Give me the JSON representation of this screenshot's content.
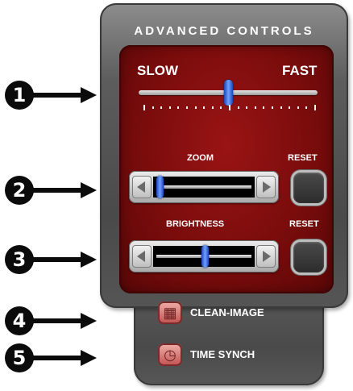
{
  "callouts": [
    "1",
    "2",
    "3",
    "4",
    "5"
  ],
  "panel": {
    "title": "ADVANCED CONTROLS"
  },
  "speed": {
    "min_label": "SLOW",
    "max_label": "FAST",
    "value_fraction": 0.5
  },
  "zoom": {
    "label": "ZOOM",
    "reset_label": "RESET",
    "value_fraction": 0.0
  },
  "brightness": {
    "label": "BRIGHTNESS",
    "reset_label": "RESET",
    "value_fraction": 0.5
  },
  "buttons": {
    "clean_image": {
      "label": "CLEAN-IMAGE",
      "icon": "clean-image-icon"
    },
    "time_synch": {
      "label": "TIME SYNCH",
      "icon": "clock-icon"
    }
  },
  "colors": {
    "panel_red": "#7a0c0c",
    "thumb_blue": "#2c5fd8",
    "panel_grey": "#4a4a4a"
  }
}
